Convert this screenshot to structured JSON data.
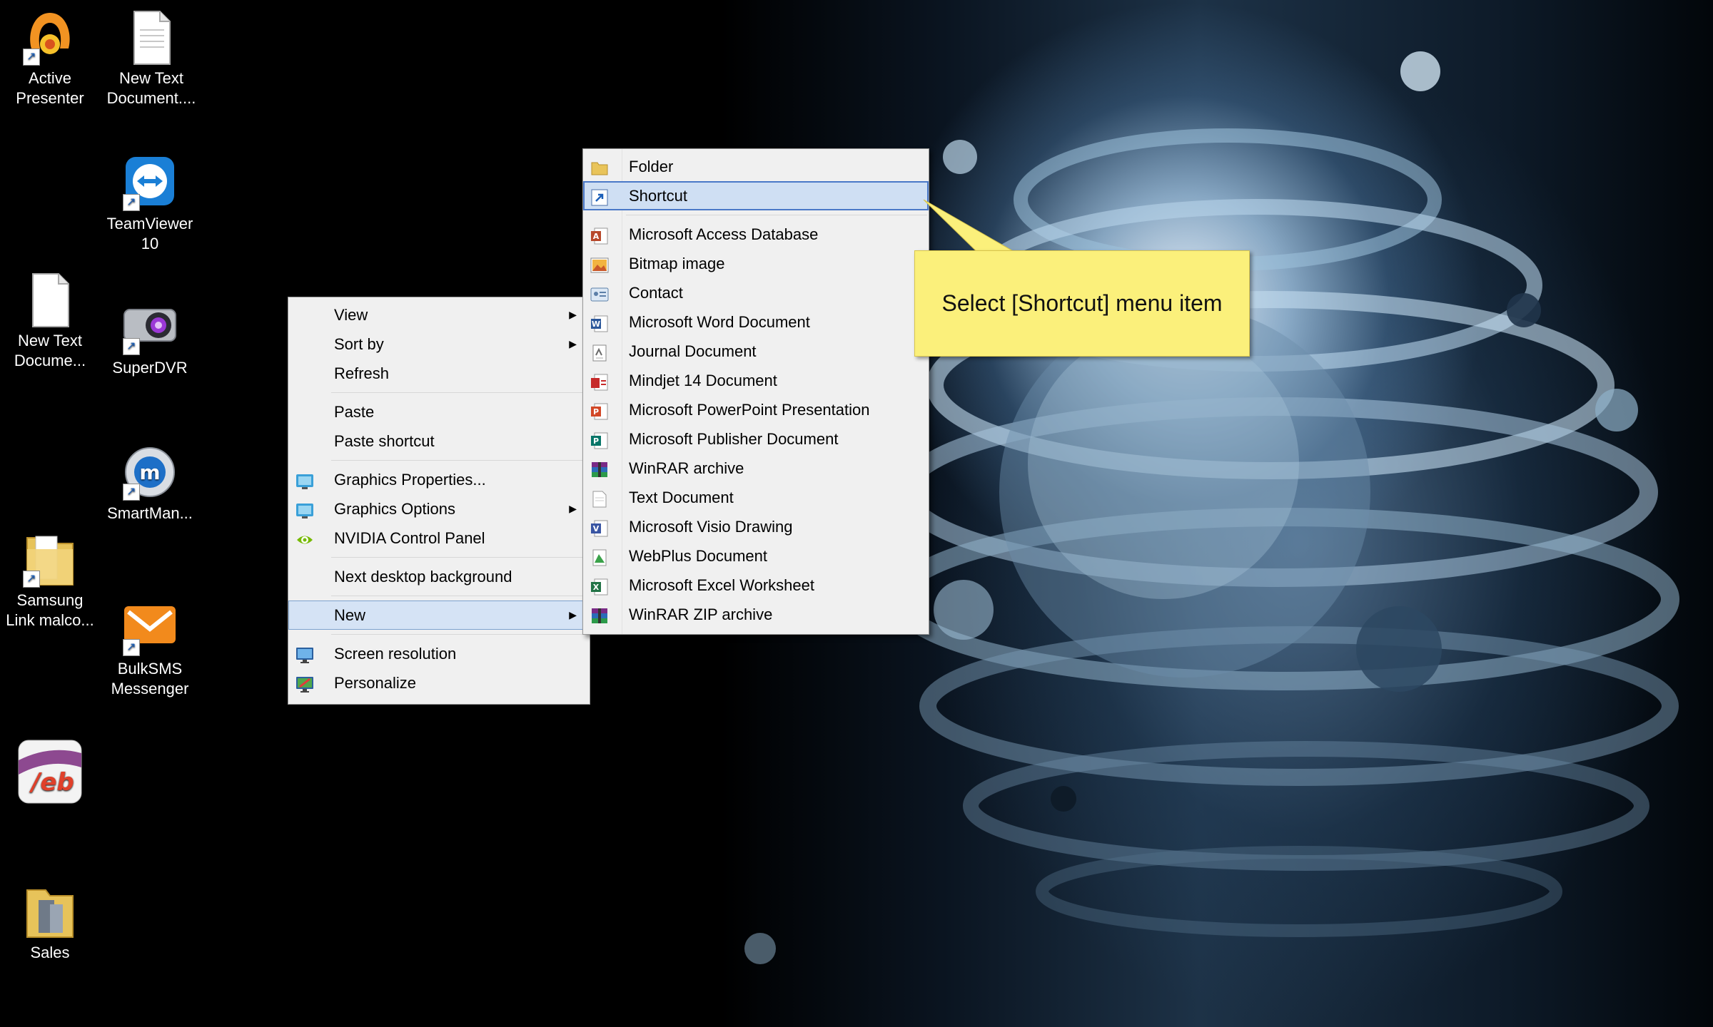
{
  "desktop": {
    "icons": [
      {
        "name": "activepresenter-icon",
        "label": "Active\nPresenter"
      },
      {
        "name": "new-text-document-icon",
        "label": "New Text\nDocument...."
      },
      {
        "name": "teamviewer-icon",
        "label": "TeamViewer\n10"
      },
      {
        "name": "new-text-document-2-icon",
        "label": "New Text\nDocume..."
      },
      {
        "name": "superdvr-icon",
        "label": "SuperDVR"
      },
      {
        "name": "smartman-icon",
        "label": "SmartMan..."
      },
      {
        "name": "samsung-link-icon",
        "label": "Samsung\nLink malco..."
      },
      {
        "name": "bulksms-icon",
        "label": "BulkSMS\nMessenger"
      },
      {
        "name": "web-icon",
        "label": ""
      },
      {
        "name": "sales-folder-icon",
        "label": "Sales"
      }
    ]
  },
  "context_menu": {
    "items": [
      {
        "label": "View",
        "submenu": true
      },
      {
        "label": "Sort by",
        "submenu": true
      },
      {
        "label": "Refresh"
      },
      {
        "label": "Paste"
      },
      {
        "label": "Paste shortcut"
      },
      {
        "label": "Graphics Properties...",
        "icon": "intel-graphics-icon"
      },
      {
        "label": "Graphics Options",
        "icon": "intel-graphics-icon",
        "submenu": true
      },
      {
        "label": "NVIDIA Control Panel",
        "icon": "nvidia-icon"
      },
      {
        "label": "Next desktop background"
      },
      {
        "label": "New",
        "submenu": true,
        "highlighted": true
      },
      {
        "label": "Screen resolution",
        "icon": "monitor-icon"
      },
      {
        "label": "Personalize",
        "icon": "personalize-icon"
      }
    ]
  },
  "new_submenu": {
    "items": [
      {
        "label": "Folder",
        "icon": "folder-icon"
      },
      {
        "label": "Shortcut",
        "icon": "shortcut-icon",
        "highlighted": true
      },
      {
        "label": "Microsoft Access Database",
        "icon": "access-icon"
      },
      {
        "label": "Bitmap image",
        "icon": "bitmap-icon"
      },
      {
        "label": "Contact",
        "icon": "contact-icon"
      },
      {
        "label": "Microsoft Word Document",
        "icon": "word-icon"
      },
      {
        "label": "Journal Document",
        "icon": "journal-icon"
      },
      {
        "label": "Mindjet 14 Document",
        "icon": "mindjet-icon"
      },
      {
        "label": "Microsoft PowerPoint Presentation",
        "icon": "powerpoint-icon"
      },
      {
        "label": "Microsoft Publisher Document",
        "icon": "publisher-icon"
      },
      {
        "label": "WinRAR archive",
        "icon": "winrar-icon"
      },
      {
        "label": "Text Document",
        "icon": "text-document-icon"
      },
      {
        "label": "Microsoft Visio Drawing",
        "icon": "visio-icon"
      },
      {
        "label": "WebPlus Document",
        "icon": "webplus-icon"
      },
      {
        "label": "Microsoft Excel Worksheet",
        "icon": "excel-icon"
      },
      {
        "label": "WinRAR ZIP archive",
        "icon": "winrar-zip-icon"
      }
    ]
  },
  "callout": {
    "text": "Select [Shortcut] menu item"
  },
  "colors": {
    "menu_bg": "#f0f0f0",
    "highlight": "#d5e3f5",
    "callout_bg": "#fbf07b"
  }
}
